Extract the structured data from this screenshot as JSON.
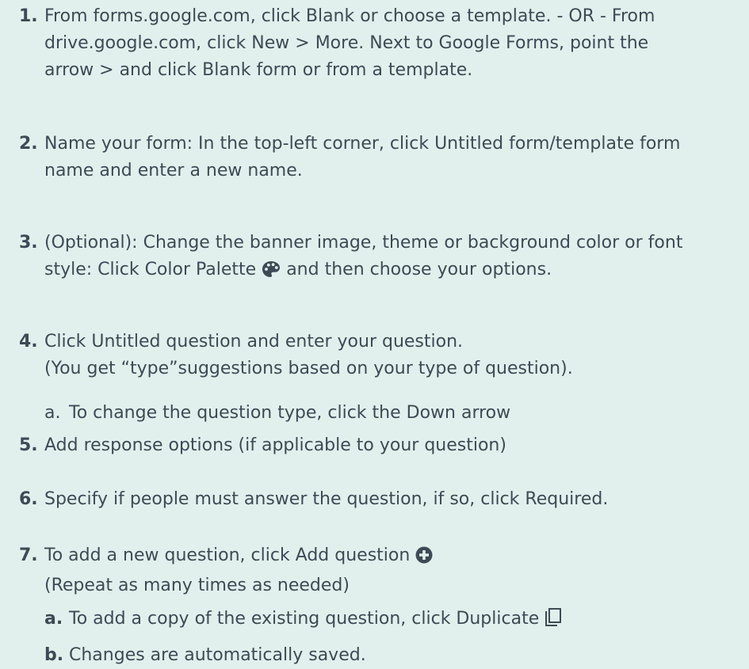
{
  "steps": [
    {
      "number": "1.",
      "lines": [
        "From forms.google.com, click Blank or choose a template. - OR - From",
        "drive.google.com, click New > More. Next to Google Forms, point the",
        "arrow > and click Blank form or from a template."
      ]
    },
    {
      "number": "2.",
      "lines": [
        "Name your form: In the top-left corner, click Untitled form/template form",
        "name and enter a new name."
      ]
    },
    {
      "number": "3.",
      "line1": "(Optional): Change the banner image, theme or background color or font",
      "line2_before": "style: Click Color Palette",
      "line2_after": "and then choose your options.",
      "icon": "palette-icon"
    },
    {
      "number": "4.",
      "lines": [
        "Click Untitled question and enter your question.",
        "(You get “type”suggestions based on your type of question)."
      ],
      "sub": {
        "marker": "a.",
        "text": "To change the question type, click the Down arrow"
      }
    },
    {
      "number": "5.",
      "text": "Add response options (if applicable to your question)"
    },
    {
      "number": "6.",
      "text": "Specify if people must answer the question, if so, click Required."
    },
    {
      "number": "7.",
      "line1": "To add a new question, click Add question",
      "line2": "(Repeat as many times as needed)",
      "icon": "add-circle-icon",
      "subs": [
        {
          "marker": "a.",
          "text": "To add a copy of the existing question, click Duplicate",
          "icon": "duplicate-icon"
        },
        {
          "marker": "b.",
          "text": "Changes are automatically saved."
        }
      ]
    }
  ],
  "colors": {
    "background": "#e2f0ed",
    "text": "#3d4a56"
  }
}
